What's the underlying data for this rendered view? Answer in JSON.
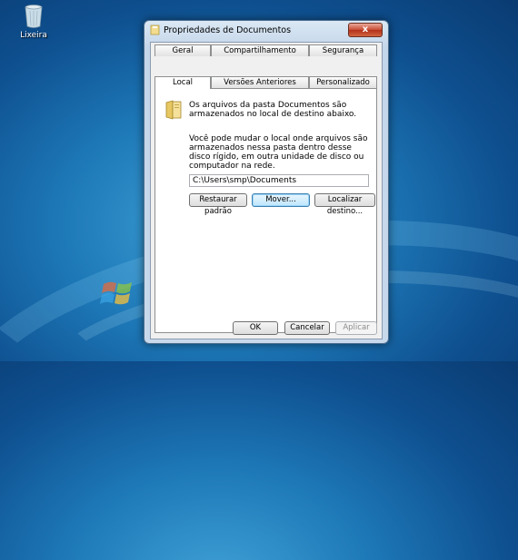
{
  "desktop": {
    "recycle_bin_label": "Lixeira"
  },
  "window": {
    "title": "Propriedades de Documentos",
    "close_symbol": "x",
    "tabs_row1": [
      "Geral",
      "Compartilhamento",
      "Segurança"
    ],
    "tabs_row2": [
      "Local",
      "Versões Anteriores",
      "Personalizado"
    ],
    "active_tab": "Local",
    "description_1": "Os arquivos da pasta Documentos são armazenados no local de destino abaixo.",
    "description_2": "Você pode mudar o local onde arquivos são armazenados nessa pasta dentro desse disco rígido, em outra unidade de disco ou computador na rede.",
    "path_value": "C:\\Users\\smp\\Documents",
    "buttons": {
      "restore": "Restaurar padrão",
      "move": "Mover...",
      "find": "Localizar destino..."
    },
    "footer": {
      "ok": "OK",
      "cancel": "Cancelar",
      "apply": "Aplicar"
    }
  },
  "colors": {
    "wallpaper": "#1d77b6",
    "titlebar": "#c4d6ea",
    "close_button": "#c74b32",
    "focus_border": "#3c7fb1"
  },
  "icons": [
    "recycle-bin-icon",
    "folder-icon",
    "windows-logo-icon",
    "close-icon"
  ]
}
